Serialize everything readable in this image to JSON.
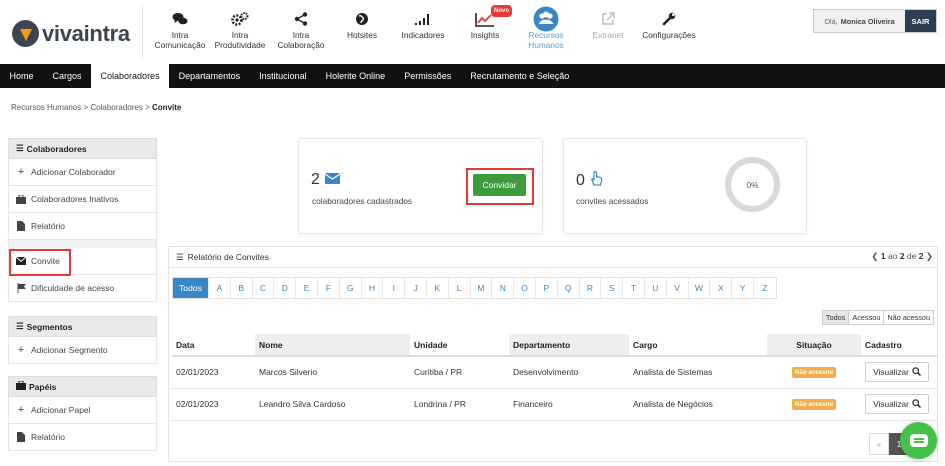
{
  "app": {
    "logo_text": "vivaintra"
  },
  "modules": [
    {
      "label_line1": "Intra",
      "label_line2": "Comunicação",
      "icon": "chat-bubbles-icon"
    },
    {
      "label_line1": "Intra",
      "label_line2": "Produtividade",
      "icon": "gears-icon"
    },
    {
      "label_line1": "Intra",
      "label_line2": "Colaboração",
      "icon": "share-icon"
    },
    {
      "label_line1": "Hotsites",
      "label_line2": "",
      "icon": "globe-icon"
    },
    {
      "label_line1": "Indicadores",
      "label_line2": "",
      "icon": "bar-signal-icon"
    },
    {
      "label_line1": "Insights",
      "label_line2": "",
      "icon": "line-chart-icon",
      "badge": "Novo"
    },
    {
      "label_line1": "Recursos",
      "label_line2": "Humanos",
      "icon": "people-icon",
      "active": true
    },
    {
      "label_line1": "Extranet",
      "label_line2": "",
      "icon": "external-link-icon",
      "disabled": true
    },
    {
      "label_line1": "Configurações",
      "label_line2": "",
      "icon": "wrench-icon"
    }
  ],
  "user": {
    "greeting": "Olá,",
    "name": "Monica Oliveira",
    "logout": "SAIR"
  },
  "nav": [
    "Home",
    "Cargos",
    "Colaboradores",
    "Departamentos",
    "Institucional",
    "Holerite Online",
    "Permissões",
    "Recrutamento e Seleção"
  ],
  "nav_active": "Colaboradores",
  "breadcrumb": {
    "part1": "Recursos Humanos",
    "part2": "Colaboradores",
    "current": "Convite",
    "separator": ">"
  },
  "sidebar": {
    "colaboradores": {
      "title": "Colaboradores",
      "items": [
        "Adicionar Colaborador",
        "Colaboradores Inativos",
        "Relatório",
        "Convite",
        "Dificuldade de acesso"
      ]
    },
    "segmentos": {
      "title": "Segmentos",
      "items": [
        "Adicionar Segmento"
      ]
    },
    "papeis": {
      "title": "Papéis",
      "items": [
        "Adicionar Papel",
        "Relatório"
      ]
    }
  },
  "stats": {
    "registered": {
      "value": "2",
      "label": "colaboradores cadastrados"
    },
    "invite_button": "Convidar",
    "accessed": {
      "value": "0",
      "label": "convites acessados",
      "percent_text": "0%",
      "percent": 0
    }
  },
  "report": {
    "title": "Relatório de Convites",
    "pager": {
      "current": "1",
      "of": "ao",
      "page": "2",
      "de": "de",
      "total": "2"
    },
    "letters": [
      "Todos",
      "A",
      "B",
      "C",
      "D",
      "E",
      "F",
      "G",
      "H",
      "I",
      "J",
      "K",
      "L",
      "M",
      "N",
      "O",
      "P",
      "Q",
      "R",
      "S",
      "T",
      "U",
      "V",
      "W",
      "X",
      "Y",
      "Z"
    ],
    "filters": [
      "Todos",
      "Acessou",
      "Não acessou"
    ],
    "columns": [
      "Data",
      "Nome",
      "Unidade",
      "Departamento",
      "Cargo",
      "Situação",
      "Cadastro"
    ],
    "rows": [
      {
        "date": "02/01/2023",
        "name": "Marcos Silverio",
        "unit": "Curitiba / PR",
        "dept": "Desenvolvimento",
        "role": "Analista de Sistemas",
        "status": "Não acessou",
        "action": "Visualizar"
      },
      {
        "date": "02/01/2023",
        "name": "Leandro Silva Cardoso",
        "unit": "Londrina / PR",
        "dept": "Financeiro",
        "role": "Analista de Negócios",
        "status": "Não acessou",
        "action": "Visualizar"
      }
    ],
    "pagination": {
      "prev": "«",
      "current": "1"
    }
  },
  "colors": {
    "accent": "#3a87c8",
    "invite": "#3d9b3d",
    "badge": "#f0ad4e",
    "highlight": "#e53935",
    "chat": "#43c247"
  }
}
